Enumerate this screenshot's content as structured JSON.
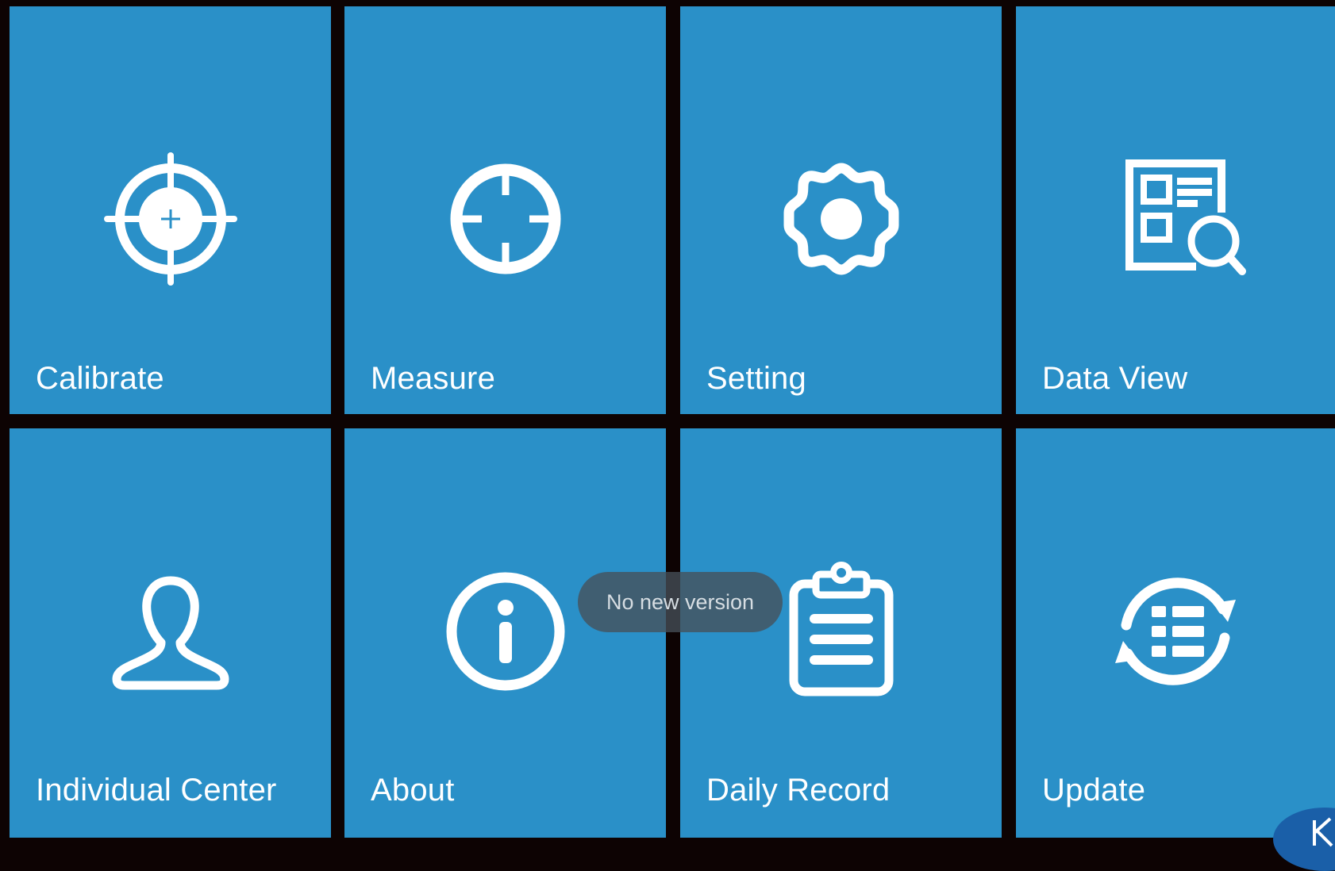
{
  "colors": {
    "tile_bg": "#2a90c8",
    "separator": "#0d0303",
    "foreground": "#ffffff",
    "toast_bg": "#46505890"
  },
  "tiles": [
    {
      "label": "Calibrate",
      "icon": "target-crosshair-icon"
    },
    {
      "label": "Measure",
      "icon": "crosshair-circle-icon"
    },
    {
      "label": "Setting",
      "icon": "gear-icon"
    },
    {
      "label": "Data View",
      "icon": "document-search-icon"
    },
    {
      "label": "Individual Center",
      "icon": "user-outline-icon"
    },
    {
      "label": "About",
      "icon": "info-circle-icon"
    },
    {
      "label": "Daily Record",
      "icon": "clipboard-list-icon"
    },
    {
      "label": "Update",
      "icon": "sync-list-icon"
    }
  ],
  "toast": {
    "message": "No new version"
  }
}
